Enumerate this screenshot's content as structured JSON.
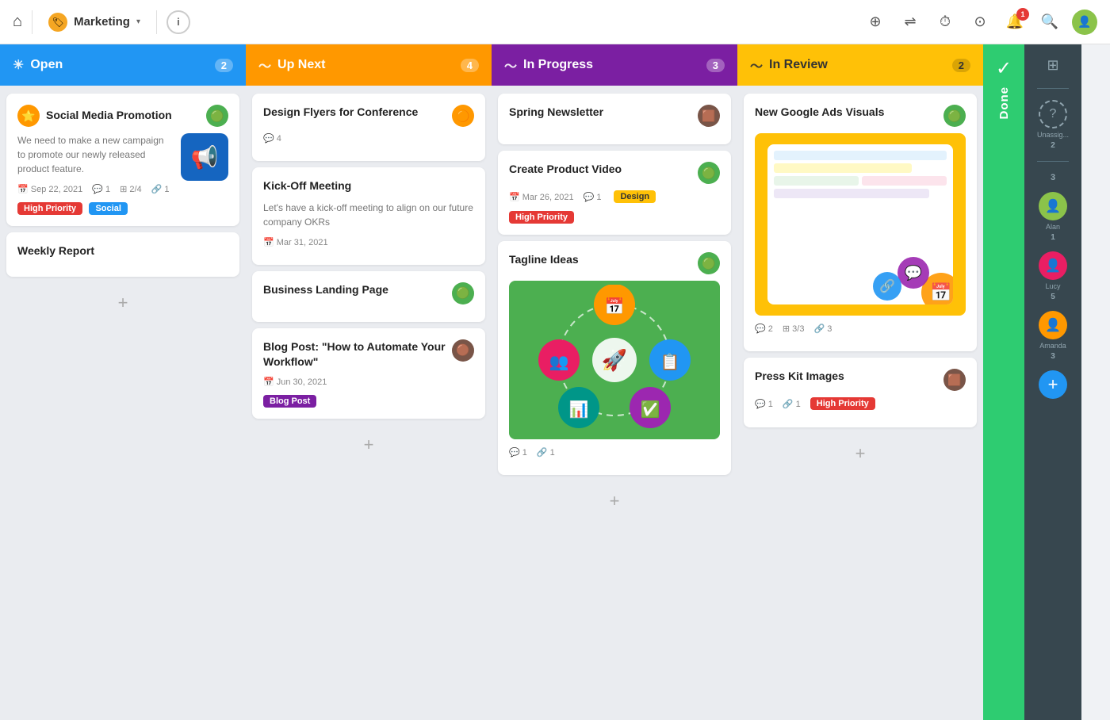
{
  "nav": {
    "home_icon": "⌂",
    "workspace_emoji": "🏷",
    "workspace_name": "Marketing",
    "info_label": "i",
    "add_icon": "+",
    "layout_icon": "⊞",
    "timer_icon": "⏱",
    "check_icon": "✓",
    "bell_icon": "🔔",
    "bell_badge": "1",
    "search_icon": "🔍"
  },
  "columns": [
    {
      "id": "open",
      "label": "Open",
      "count": "2",
      "color": "blue",
      "cards": [
        {
          "id": "social-media",
          "title": "Social Media Promotion",
          "desc": "We need to make a new campaign to promote our newly released product feature.",
          "has_thumb": true,
          "thumb_type": "megaphone",
          "meta": {
            "date": "Sep 22, 2021",
            "comments": "1",
            "tasks": "2/4",
            "links": "1"
          },
          "tags": [
            "High Priority",
            "Social"
          ],
          "avatar": "🟢"
        },
        {
          "id": "weekly-report",
          "title": "Weekly Report",
          "desc": "",
          "has_thumb": false,
          "meta": null,
          "tags": [],
          "avatar": null
        }
      ]
    },
    {
      "id": "upnext",
      "label": "Up Next",
      "count": "4",
      "color": "orange",
      "cards": [
        {
          "id": "design-flyers",
          "title": "Design Flyers for Conference",
          "desc": "",
          "has_thumb": false,
          "meta": {
            "comments": "4"
          },
          "tags": [],
          "avatar": "🟠"
        },
        {
          "id": "kickoff-meeting",
          "title": "Kick-Off Meeting",
          "desc": "Let's have a kick-off meeting to align on our future company OKRs",
          "has_thumb": false,
          "meta": {
            "date": "Mar 31, 2021"
          },
          "tags": [],
          "avatar": null
        },
        {
          "id": "business-landing",
          "title": "Business Landing Page",
          "desc": "",
          "has_thumb": false,
          "meta": null,
          "tags": [],
          "avatar": "🟢"
        },
        {
          "id": "blog-post",
          "title": "Blog Post: \"How to Automate Your Workflow\"",
          "desc": "",
          "has_thumb": false,
          "meta": {
            "date": "Jun 30, 2021"
          },
          "tags": [
            "Blog Post"
          ],
          "avatar": "🟤"
        }
      ]
    },
    {
      "id": "inprogress",
      "label": "In Progress",
      "count": "3",
      "color": "purple",
      "cards": [
        {
          "id": "spring-newsletter",
          "title": "Spring Newsletter",
          "desc": "",
          "has_thumb": false,
          "meta": null,
          "tags": [],
          "avatar": "🟫"
        },
        {
          "id": "create-product-video",
          "title": "Create Product Video",
          "desc": "",
          "has_thumb": false,
          "meta": {
            "date": "Mar 26, 2021",
            "comments": "1"
          },
          "tags": [
            "Design",
            "High Priority"
          ],
          "avatar": "🟢"
        },
        {
          "id": "tagline-ideas",
          "title": "Tagline Ideas",
          "desc": "",
          "has_thumb": true,
          "thumb_type": "tagline",
          "meta": {
            "comments": "1",
            "links": "1"
          },
          "tags": [],
          "avatar": "🟢"
        }
      ]
    },
    {
      "id": "inreview",
      "label": "In Review",
      "count": "2",
      "color": "yellow",
      "cards": [
        {
          "id": "google-ads",
          "title": "New Google Ads Visuals",
          "desc": "",
          "has_thumb": true,
          "thumb_type": "ads",
          "meta": {
            "comments": "2",
            "tasks": "3/3",
            "links": "3"
          },
          "tags": [],
          "avatar": "🟢"
        },
        {
          "id": "press-kit",
          "title": "Press Kit Images",
          "desc": "",
          "has_thumb": false,
          "meta": {
            "comments": "1",
            "links": "1"
          },
          "tags": [
            "High Priority"
          ],
          "avatar": "🟫"
        }
      ]
    }
  ],
  "done": {
    "label": "Done",
    "check": "✓"
  },
  "right_panel": {
    "layout_icon": "⊞",
    "unassigned_label": "Unassig...",
    "unassigned_count": "2",
    "assignees": [
      {
        "name": "Alan",
        "count": "1",
        "color": "#8BC34A"
      },
      {
        "name": "Lucy",
        "count": "5",
        "color": "#E91E63"
      },
      {
        "name": "Amanda",
        "count": "3",
        "color": "#FF9800"
      }
    ],
    "add_label": "+",
    "total_count": "3"
  },
  "labels": {
    "add_card": "+",
    "high_priority": "High Priority",
    "social": "Social",
    "design": "Design",
    "blog_post": "Blog Post"
  }
}
